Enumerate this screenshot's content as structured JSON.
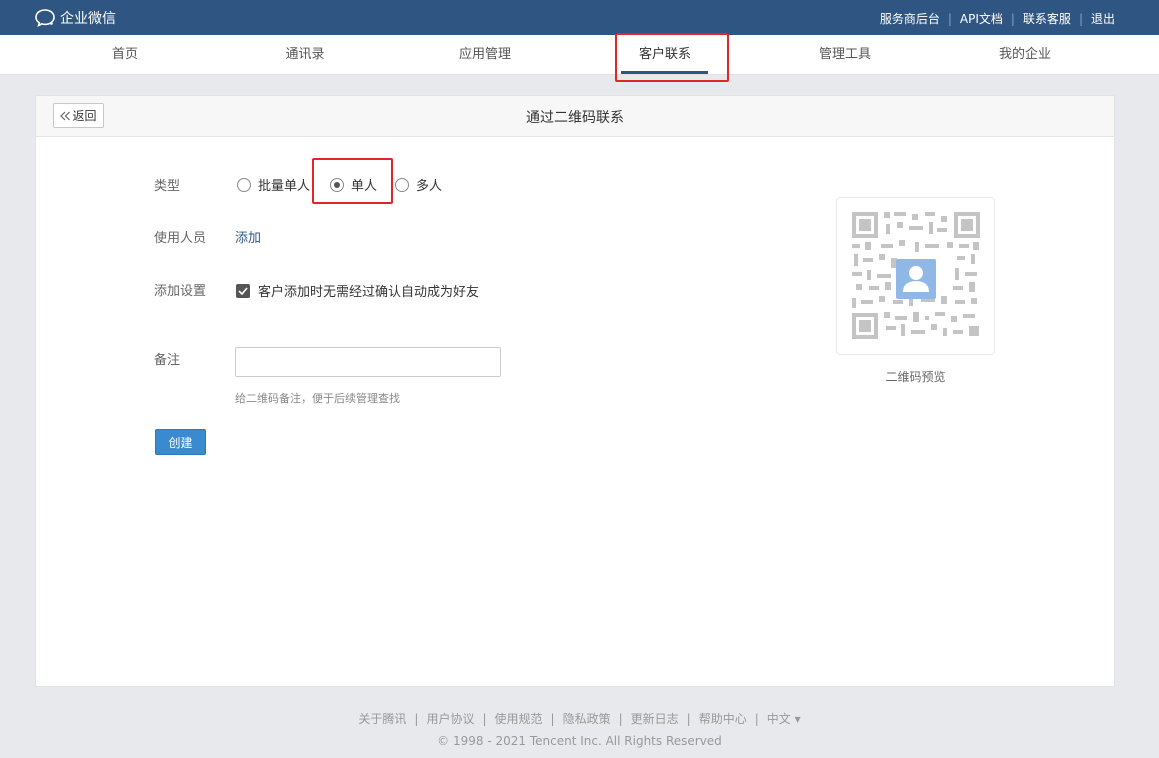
{
  "header": {
    "logo_text": "企业微信",
    "links": [
      "服务商后台",
      "API文档",
      "联系客服",
      "退出"
    ]
  },
  "nav": {
    "tabs": [
      "首页",
      "通讯录",
      "应用管理",
      "客户联系",
      "管理工具",
      "我的企业"
    ],
    "active": "客户联系"
  },
  "page": {
    "back_label": "返回",
    "title": "通过二维码联系"
  },
  "form": {
    "type_label": "类型",
    "type_options": [
      "批量单人",
      "单人",
      "多人"
    ],
    "type_selected": "单人",
    "users_label": "使用人员",
    "users_add": "添加",
    "settings_label": "添加设置",
    "auto_friend_text": "客户添加时无需经过确认自动成为好友",
    "auto_friend_checked": true,
    "note_label": "备注",
    "note_value": "",
    "note_hint": "给二维码备注，便于后续管理查找",
    "create_label": "创建"
  },
  "qr": {
    "caption": "二维码预览"
  },
  "footer": {
    "links": [
      "关于腾讯",
      "用户协议",
      "使用规范",
      "隐私政策",
      "更新日志",
      "帮助中心",
      "中文 ▾"
    ],
    "copyright": "© 1998 - 2021 Tencent Inc. All Rights Reserved"
  },
  "colors": {
    "topbar": "#2f5682",
    "highlight": "#e0262a",
    "primary_button": "#3a8ad0",
    "link": "#2f5a8a"
  }
}
